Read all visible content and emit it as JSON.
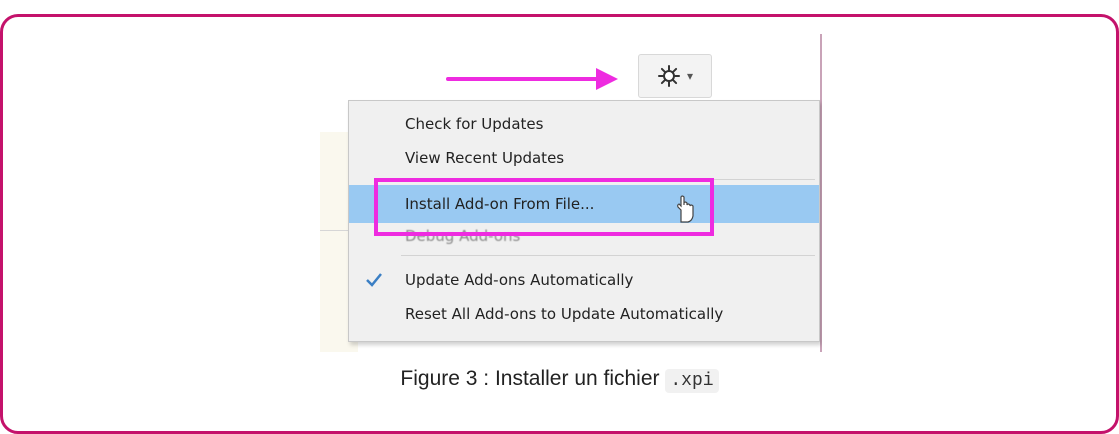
{
  "menu": {
    "items": [
      {
        "label": "Check for Updates"
      },
      {
        "label": "View Recent Updates"
      },
      {
        "label": "Install Add-on From File..."
      },
      {
        "label": "Debug Add-ons"
      },
      {
        "label": "Update Add-ons Automatically",
        "checked": true
      },
      {
        "label": "Reset All Add-ons to Update Automatically"
      }
    ],
    "highlighted_index": 2
  },
  "toolbar": {
    "gear_icon": "gear-icon",
    "dropdown_icon": "chevron-down-icon"
  },
  "annotations": {
    "arrow_color": "#ee2be0",
    "highlight_box_color": "#ee2be0"
  },
  "caption": {
    "text": "Figure 3 : Installer un fichier",
    "code": ".xpi"
  },
  "colors": {
    "frame_border": "#c4126b",
    "menu_highlight": "#99c9f2",
    "check_color": "#3b7fc4"
  }
}
